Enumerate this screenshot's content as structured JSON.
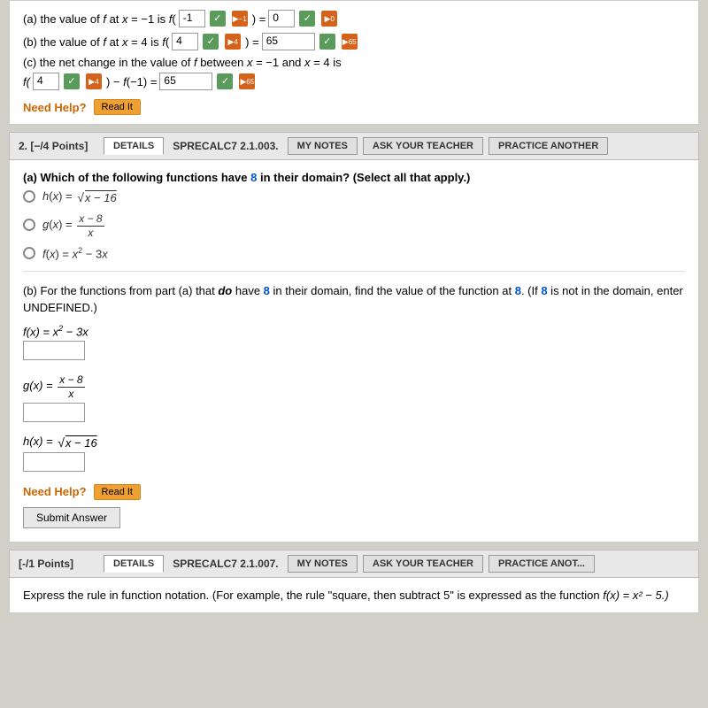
{
  "top": {
    "line_a": {
      "text": "(a) the value of",
      "var_f": "f",
      "at_text": "at",
      "var_x": "x",
      "eq_text": "= −1 is",
      "f_notation": "f(",
      "input1_val": "-1",
      "check1": "✓",
      "input2_val": "-1",
      "equals": ")=",
      "input3_val": "0",
      "check2": "✓",
      "final_val": "0"
    },
    "line_b": {
      "text": "(b) the value of",
      "var_f": "f",
      "at_text": "at",
      "var_x": "x",
      "eq_text": "= 4 is",
      "f_notation": "f(",
      "input1_val": "4",
      "check1": "✓",
      "input2_val": "4",
      "equals": ")=",
      "input3_val": "65",
      "check2": "✓",
      "final_val": "65"
    },
    "line_c_text": "(c) the net change in the value of",
    "line_c_var": "f",
    "line_c_between": "between",
    "line_c_x1": "x = −1 and",
    "line_c_x2": "x = 4 is",
    "line_c_f": "f(",
    "line_c_input1": "4",
    "line_c_input2": "4",
    "line_c_minus": ") − f(−1) =",
    "line_c_input3": "65",
    "line_c_check": "✓",
    "line_c_final": "65",
    "need_help": "Need Help?",
    "read_it": "Read It"
  },
  "problem2": {
    "points": "2.  [−/4 Points]",
    "details_tab": "DETAILS",
    "problem_id": "SPRECALC7 2.1.003.",
    "my_notes_tab": "MY NOTES",
    "ask_teacher_tab": "ASK YOUR TEACHER",
    "practice_tab": "PRACTICE ANOTHER",
    "part_a_label": "(a) Which of the following functions have",
    "part_a_highlight": "8",
    "part_a_rest": "in their domain? (Select all that apply.)",
    "options": [
      {
        "label": "h(x) = √x − 16",
        "id": "hx"
      },
      {
        "label": "g(x) = (x − 8) / x",
        "id": "gx"
      },
      {
        "label": "f(x) = x² − 3x",
        "id": "fx"
      }
    ],
    "part_b_intro": "(b) For the functions from part (a) that",
    "part_b_do": "do",
    "part_b_rest1": "have",
    "part_b_highlight": "8",
    "part_b_rest2": "in their domain, find the value of the function at",
    "part_b_highlight2": "8.",
    "part_b_paren": "(If",
    "part_b_highlight3": "8",
    "part_b_rest3": "is not in the domain, enter",
    "part_b_undefined": "UNDEFINED.)",
    "funcs": [
      {
        "label": "f(x) = x² − 3x",
        "id": "fx_ans"
      },
      {
        "label": "g(x) = (x − 8) / x",
        "id": "gx_ans"
      },
      {
        "label": "h(x) = √x − 16",
        "id": "hx_ans"
      }
    ],
    "need_help": "Need Help?",
    "read_it": "Read It",
    "submit_btn": "Submit Answer"
  },
  "problem3": {
    "points": "[-/1 Points]",
    "details_tab": "DETAILS",
    "problem_id": "SPRECALC7 2.1.007.",
    "my_notes_tab": "MY NOTES",
    "ask_teacher_tab": "ASK YOUR TEACHER",
    "practice_tab": "PRACTICE ANOT...",
    "body_text": "Express the rule in function notation. (For example, the rule \"square, then subtract 5\" is expressed as the function",
    "body_math": "f(x) = x² − 5.)"
  }
}
